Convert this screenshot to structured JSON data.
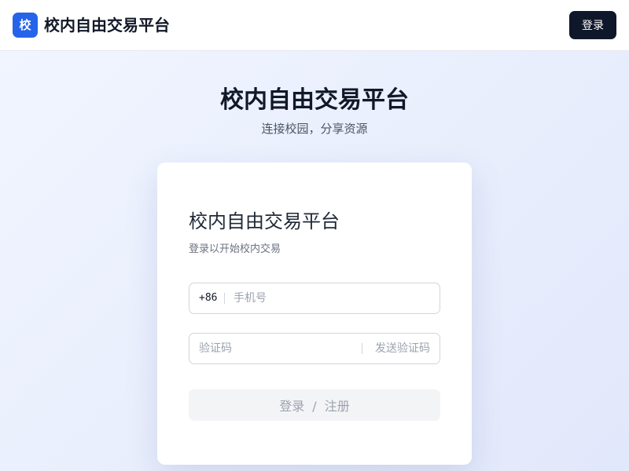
{
  "header": {
    "logo_char": "校",
    "title": "校内自由交易平台",
    "login_label": "登录"
  },
  "hero": {
    "title": "校内自由交易平台",
    "subtitle": "连接校园，分享资源"
  },
  "card": {
    "title": "校内自由交易平台",
    "subtitle": "登录以开始校内交易",
    "phone": {
      "prefix": "+86",
      "placeholder": "手机号",
      "value": ""
    },
    "code": {
      "placeholder": "验证码",
      "value": "",
      "send_label": "发送验证码"
    },
    "submit": {
      "login": "登录",
      "separator": "/",
      "register": "注册"
    }
  },
  "colors": {
    "accent": "#2563eb",
    "dark_button": "#0f172a",
    "disabled_button": "#f3f4f6"
  }
}
